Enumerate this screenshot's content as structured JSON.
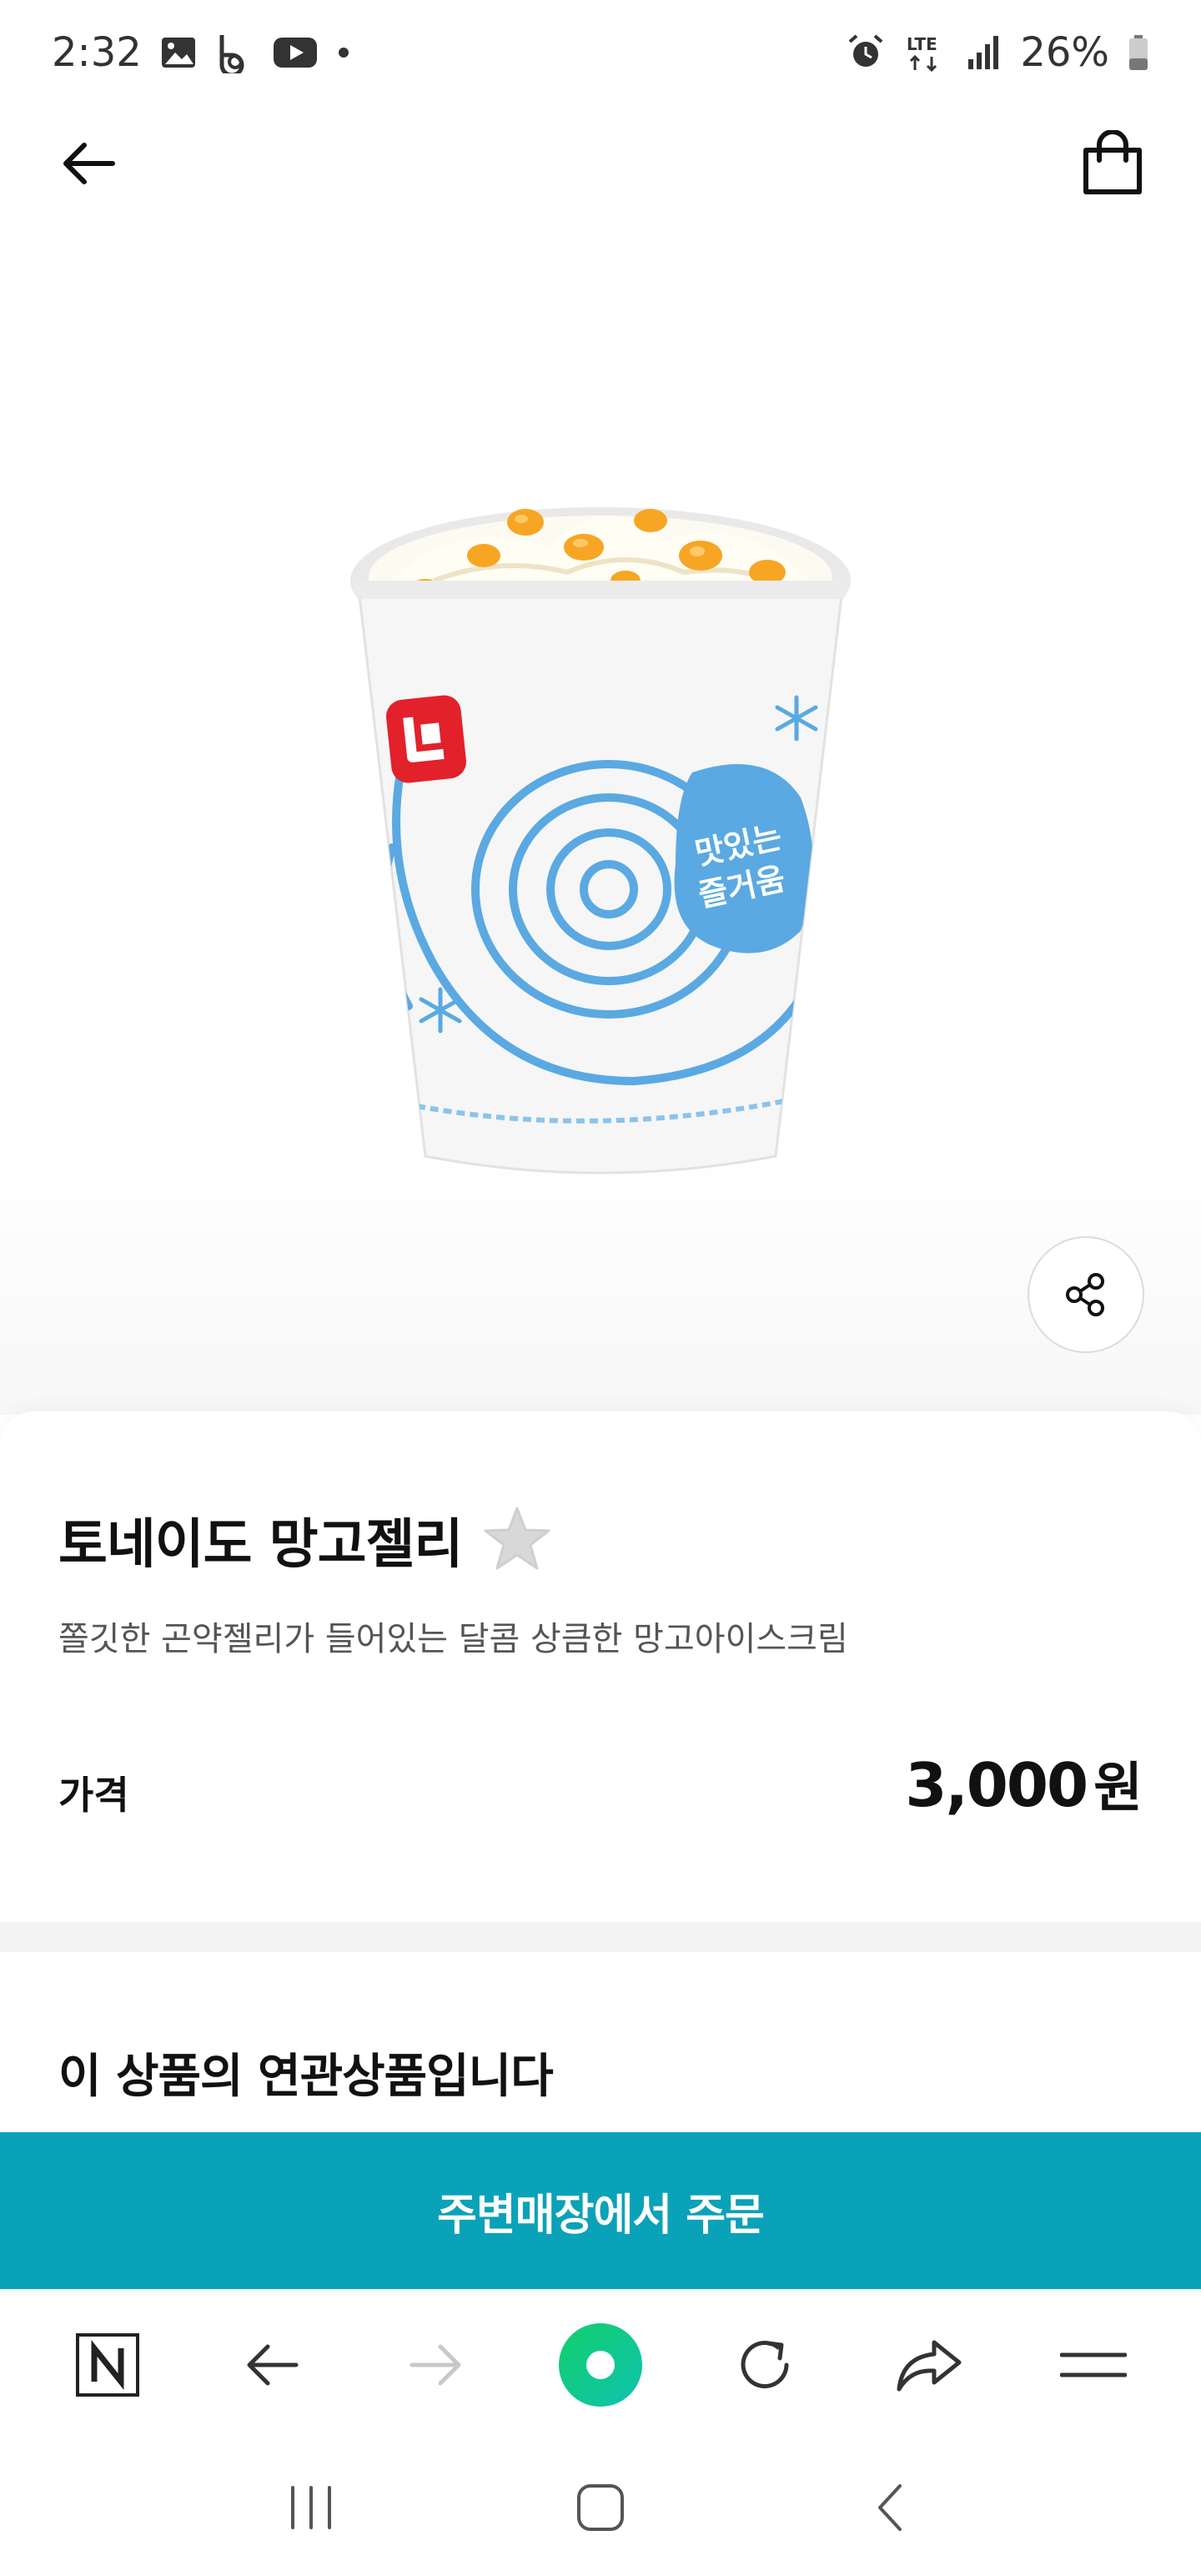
{
  "status_bar": {
    "time": "2:32",
    "network": "LTE",
    "battery": "26%",
    "left_icons": [
      "gallery-icon",
      "b-app-icon",
      "youtube-icon",
      "dot-icon"
    ],
    "right_icons": [
      "alarm-icon",
      "lte-icon",
      "signal-icon",
      "battery-icon"
    ]
  },
  "top_nav": {
    "back_icon": "arrow-left-icon",
    "cart_icon": "shopping-bag-icon"
  },
  "product": {
    "name": "토네이도 망고젤리",
    "description": "쫄깃한 곤약젤리가 들어있는 달콤 상큼한 망고아이스크림",
    "price_label": "가격",
    "price": "3,000",
    "currency": "원",
    "cup_text": "맛있는 즐거움",
    "favorite_icon": "star-icon",
    "share_icon": "share-icon"
  },
  "related": {
    "title": "이 상품의 연관상품입니다"
  },
  "order_button": {
    "label": "주변매장에서 주문"
  },
  "browser_bar": {
    "items": [
      "naver-icon",
      "back-arrow-icon",
      "forward-arrow-icon",
      "green-dot-icon",
      "refresh-icon",
      "share-arrow-icon",
      "menu-icon"
    ]
  },
  "system_nav": {
    "items": [
      "recent-apps-icon",
      "home-icon",
      "back-icon"
    ]
  },
  "colors": {
    "accent": "#0aa2b8",
    "green": "#12c96a",
    "cup_blue": "#5aa9e2",
    "brand_red": "#e2212b",
    "mango": "#f6a623"
  }
}
